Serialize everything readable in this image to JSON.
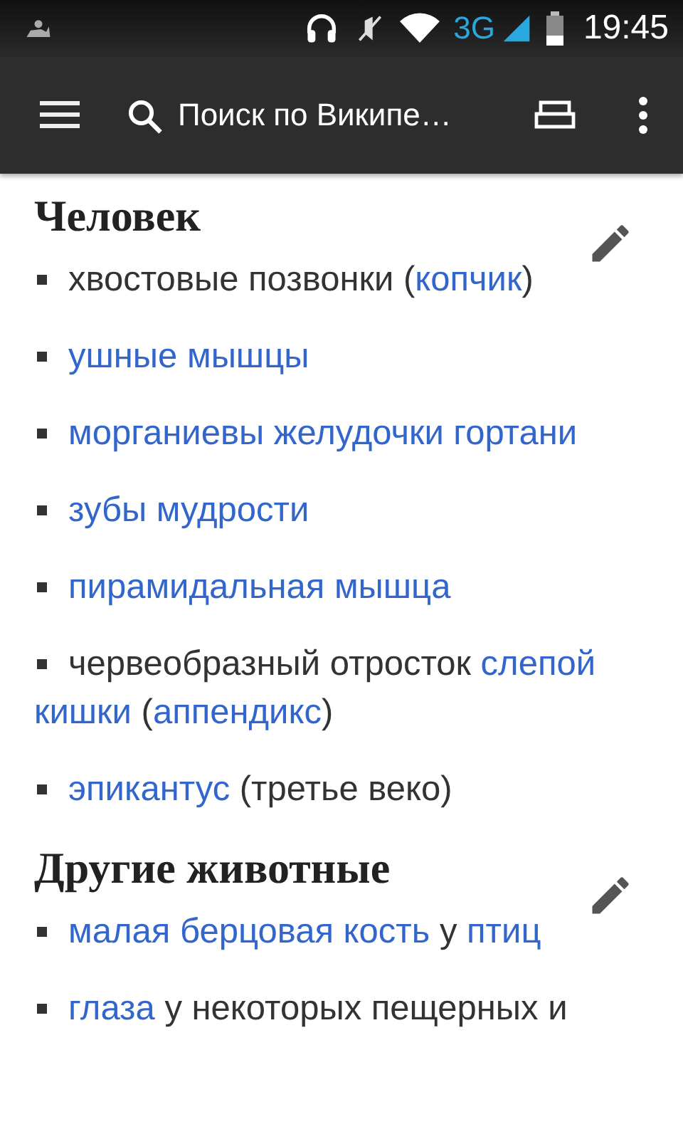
{
  "status_bar": {
    "network": "3G",
    "time": "19:45"
  },
  "toolbar": {
    "search": {
      "placeholder": "Поиск по Википе…"
    }
  },
  "sections": [
    {
      "heading": "Человек",
      "items": [
        [
          {
            "text": "хвостовые позвонки ",
            "link": false
          },
          {
            "text": "(",
            "link": false
          },
          {
            "text": "копчик",
            "link": true
          },
          {
            "text": ")",
            "link": false
          }
        ],
        [
          {
            "text": "ушные мышцы",
            "link": true
          }
        ],
        [
          {
            "text": "морганиевы желудочки гортани",
            "link": true
          }
        ],
        [
          {
            "text": "зубы мудрости",
            "link": true
          }
        ],
        [
          {
            "text": "пирамидальная мышца",
            "link": true
          }
        ],
        [
          {
            "text": "червеобразный отросток ",
            "link": false
          },
          {
            "text": "слепой ",
            "link": true
          },
          {
            "text": "кишки",
            "link": true
          },
          {
            "text": " (",
            "link": false
          },
          {
            "text": "аппендикс",
            "link": true
          },
          {
            "text": ")",
            "link": false
          }
        ],
        [
          {
            "text": "эпикантус",
            "link": true
          },
          {
            "text": " (третье веко)",
            "link": false
          }
        ]
      ]
    },
    {
      "heading": "Другие животные",
      "items": [
        [
          {
            "text": "малая берцовая кость",
            "link": true
          },
          {
            "text": " у ",
            "link": false
          },
          {
            "text": "птиц",
            "link": true
          }
        ],
        [
          {
            "text": "глаза",
            "link": true
          },
          {
            "text": " у некоторых пещерных и",
            "link": false
          }
        ]
      ]
    }
  ]
}
